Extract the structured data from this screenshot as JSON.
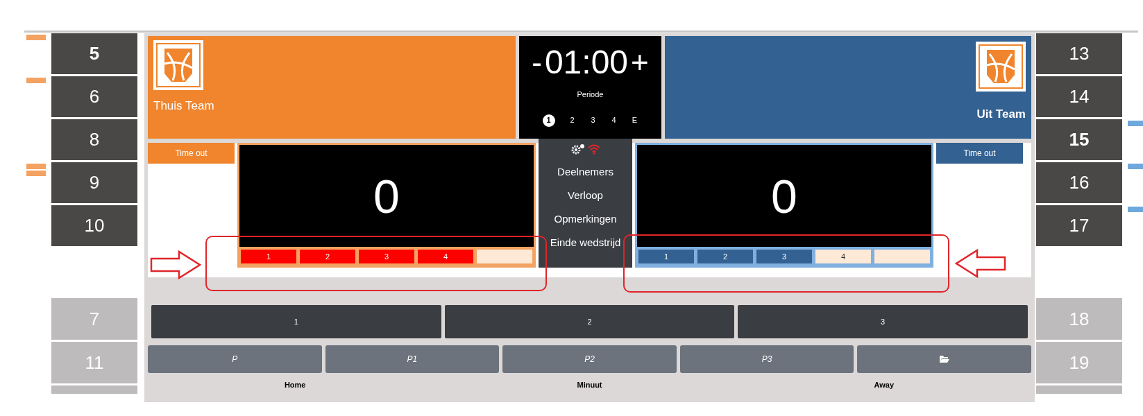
{
  "home": {
    "name": "Thuis Team",
    "timeout": "Time out",
    "score": "0",
    "team_fouls": [
      {
        "label": "1",
        "on": true
      },
      {
        "label": "2",
        "on": true
      },
      {
        "label": "3",
        "on": true
      },
      {
        "label": "4",
        "on": true
      },
      {
        "on": false
      }
    ],
    "players": [
      {
        "number": "5",
        "bold": true,
        "on_court": true,
        "fouls": [
          {
            "kind": "flag"
          }
        ]
      },
      {
        "number": "6",
        "bold": false,
        "on_court": true,
        "fouls": [
          {
            "kind": "flag"
          }
        ]
      },
      {
        "number": "8",
        "bold": false,
        "on_court": true
      },
      {
        "number": "9",
        "bold": false,
        "on_court": true,
        "fouls": [
          {
            "kind": "flag"
          },
          {
            "kind": "flag"
          }
        ]
      },
      {
        "number": "10",
        "bold": false,
        "on_court": true
      }
    ],
    "bench": [
      {
        "number": "7"
      },
      {
        "number": "11"
      }
    ]
  },
  "clock": {
    "minus": "-",
    "time": "01:00",
    "plus": "+",
    "label": "Periode",
    "periods": [
      {
        "label": "1",
        "selected": true
      },
      {
        "label": "2",
        "selected": false
      },
      {
        "label": "3",
        "selected": false
      },
      {
        "label": "4",
        "selected": false
      },
      {
        "label": "E",
        "selected": false
      }
    ]
  },
  "menu": [
    "Deelnemers",
    "Verloop",
    "Opmerkingen",
    "Einde wedstrijd"
  ],
  "away": {
    "name": "Uit Team",
    "timeout": "Time out",
    "score": "0",
    "team_fouls": [
      {
        "label": "1",
        "on": true
      },
      {
        "label": "2",
        "on": true
      },
      {
        "label": "3",
        "on": true
      },
      {
        "label": "4",
        "on": false
      },
      {
        "on": false
      }
    ],
    "players": [
      {
        "number": "13",
        "bold": false,
        "on_court": true
      },
      {
        "number": "14",
        "bold": false,
        "on_court": true
      },
      {
        "number": "15",
        "bold": true,
        "on_court": true,
        "fouls": [
          {
            "kind": "flag"
          }
        ]
      },
      {
        "number": "16",
        "bold": false,
        "on_court": true,
        "fouls": [
          {
            "kind": "flag"
          }
        ]
      },
      {
        "number": "17",
        "bold": false,
        "on_court": true,
        "fouls": [
          {
            "kind": "flag"
          }
        ]
      }
    ],
    "bench": [
      {
        "number": "18"
      },
      {
        "number": "19"
      }
    ]
  },
  "quarters": [
    "1",
    "2",
    "3"
  ],
  "actions": [
    {
      "kind": "text",
      "label": "P"
    },
    {
      "kind": "text",
      "label": "P1"
    },
    {
      "kind": "text",
      "label": "P2"
    },
    {
      "kind": "text",
      "label": "P3"
    },
    {
      "kind": "folder"
    }
  ],
  "footer": [
    "Home",
    "Minuut",
    "Away"
  ]
}
